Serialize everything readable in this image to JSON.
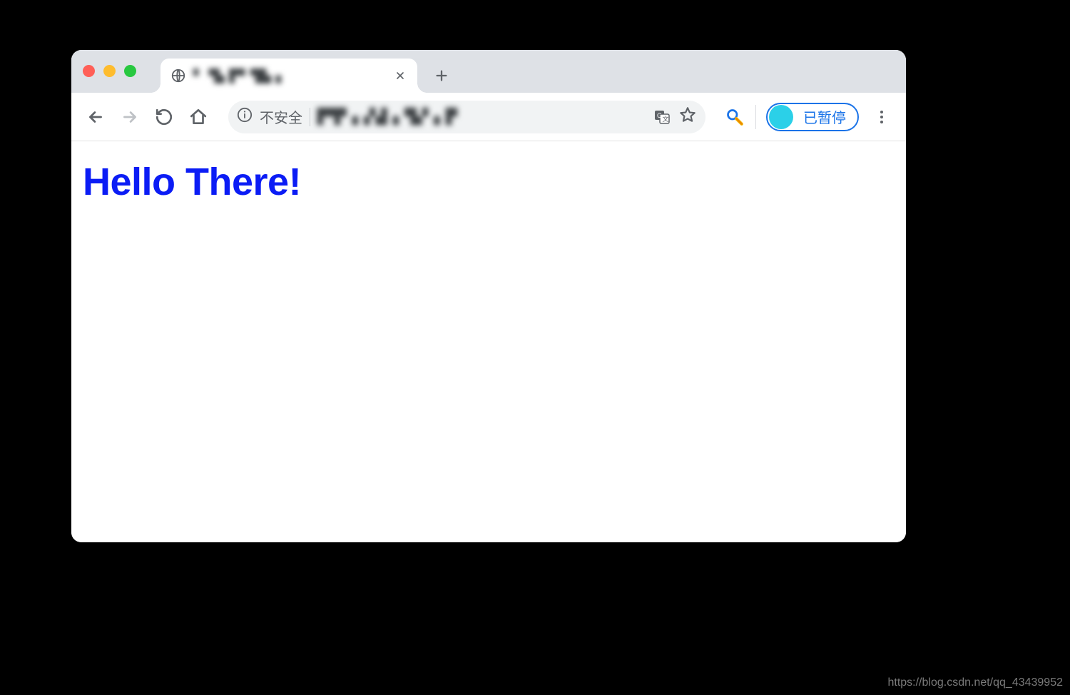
{
  "window": {
    "tab": {
      "title_obscured": "▘▝▙ ▛▘▜▙ ▖",
      "favicon": "globe-icon"
    }
  },
  "toolbar": {
    "insecure_label": "不安全",
    "url_obscured": "▛▜▘▖▞▟▗▝▙▘▖▛",
    "profile_label": "已暂停"
  },
  "page": {
    "heading": "Hello There!"
  },
  "watermark": "https://blog.csdn.net/qq_43439952"
}
